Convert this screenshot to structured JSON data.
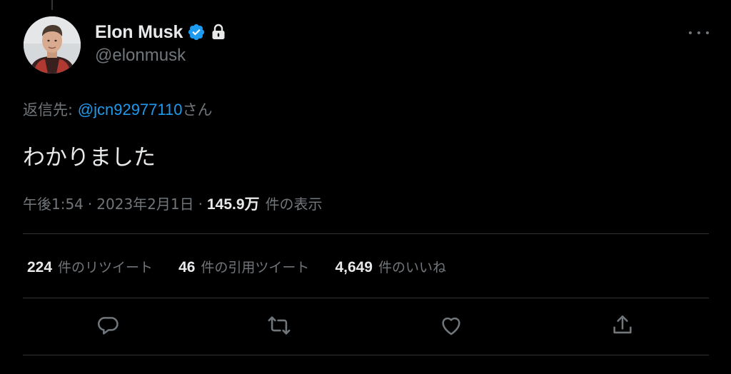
{
  "author": {
    "display_name": "Elon Musk",
    "handle": "@elonmusk",
    "verified_icon": "verified-badge-icon",
    "lock_icon": "lock-icon"
  },
  "reply": {
    "prefix": "返信先: ",
    "mention": "@jcn92977110",
    "suffix": "さん"
  },
  "tweet": {
    "text": "わかりました"
  },
  "meta": {
    "time": "午後1:54",
    "separator": "·",
    "date": "2023年2月1日",
    "views_count": "145.9万",
    "views_label": "件の表示"
  },
  "stats": [
    {
      "count": "224",
      "label": "件のリツイート"
    },
    {
      "count": "46",
      "label": "件の引用ツイート"
    },
    {
      "count": "4,649",
      "label": "件のいいね"
    }
  ],
  "actions": {
    "reply_icon": "reply-icon",
    "retweet_icon": "retweet-icon",
    "like_icon": "heart-icon",
    "share_icon": "share-icon"
  },
  "colors": {
    "background": "#000000",
    "text_primary": "#e7e9ea",
    "text_secondary": "#71767b",
    "accent": "#1d9bf0",
    "divider": "#2f3336"
  }
}
